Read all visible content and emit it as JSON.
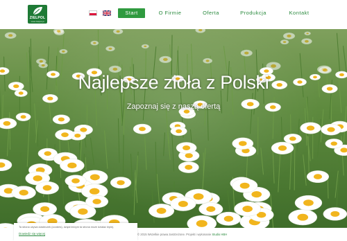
{
  "header": {
    "logo_text": "ZIELPOL",
    "logo_sub": "www.zielpol.pl",
    "languages": [
      {
        "code": "pl",
        "icon": "flag-poland-icon"
      },
      {
        "code": "en",
        "icon": "flag-uk-icon"
      }
    ],
    "nav": [
      {
        "label": "Start",
        "active": true
      },
      {
        "label": "O Firmie"
      },
      {
        "label": "Oferta"
      },
      {
        "label": "Produkcja"
      },
      {
        "label": "Kontakt"
      }
    ]
  },
  "hero": {
    "title": "Najlepsze zioła z Polski",
    "subtitle": "Zapoznaj się z naszą ofertą",
    "background": "chamomile-field-image"
  },
  "cookie": {
    "text": "Ta strona używa ciasteczek (cookies), dzięki którym ta strona może działać lepiej.",
    "link": "Dowiedz się więcej"
  },
  "footer": {
    "text": "© 2015 Wszelkie prawa zastrzeżone. Projekt i wykonanie ",
    "link": "Studio HBH"
  },
  "colors": {
    "brand_green": "#2f9a3f",
    "nav_text": "#2a8a3e",
    "hero_text": "#ffffff"
  }
}
